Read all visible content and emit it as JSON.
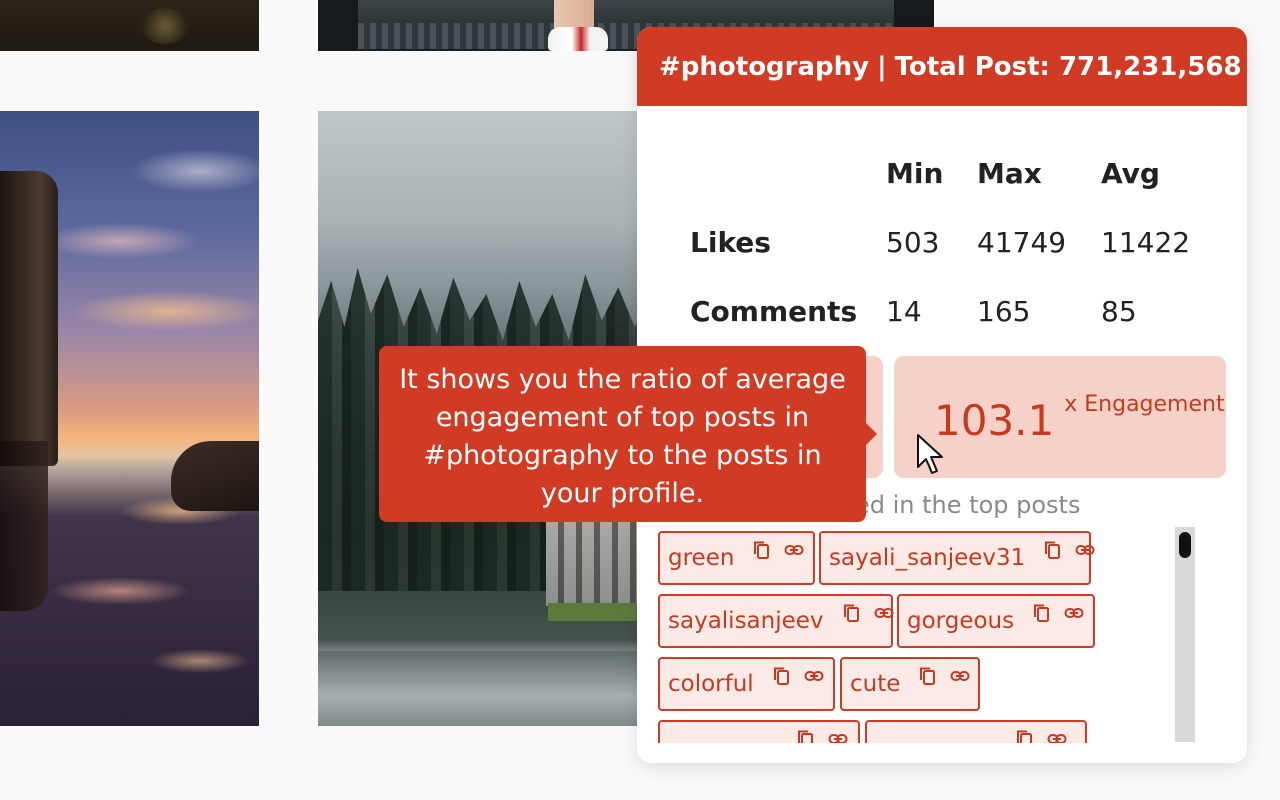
{
  "panel": {
    "hashtag": "#photography",
    "separator": "|",
    "total_label": "Total Post: 771,231,568",
    "minimize_label": ""
  },
  "stats": {
    "headers": [
      "",
      "Min",
      "Max",
      "Avg"
    ],
    "rows": [
      {
        "label": "Likes",
        "min": "503",
        "max": "41749",
        "avg": "11422"
      },
      {
        "label": "Comments",
        "min": "14",
        "max": "165",
        "avg": "85"
      }
    ]
  },
  "engagement": {
    "value": "103.1",
    "unit": "x Engagement"
  },
  "top_posts_label": "ed in the top posts",
  "tooltip": {
    "text": "It shows you the ratio of average engagement of top posts in #photography to the posts in your profile."
  },
  "tags": [
    "green",
    "sayali_sanjeev31",
    "sayalisanjeev",
    "gorgeous",
    "colorful",
    "cute"
  ],
  "icons": {
    "copy": "copy-icon",
    "link": "link-icon",
    "minimize": "minimize-icon",
    "cursor": "mouse-cursor-icon"
  },
  "colors": {
    "accent": "#d13b24",
    "accent_light": "#f5d1c7",
    "tag_bg": "#fbeae5",
    "accent_text": "#c63a22"
  }
}
